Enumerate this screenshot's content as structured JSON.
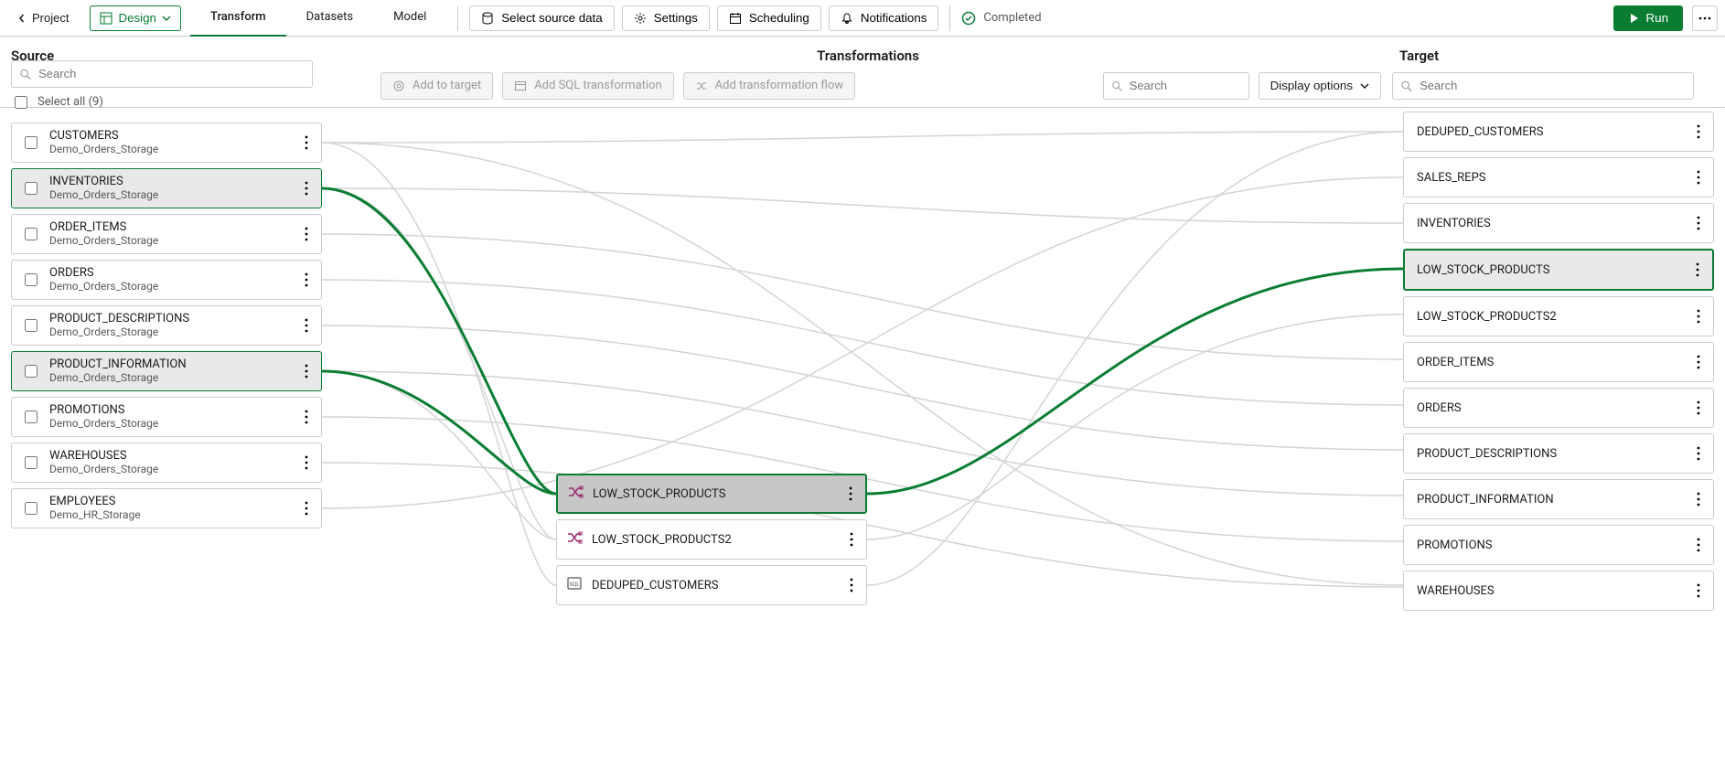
{
  "topbar": {
    "back_label": "Project",
    "design_label": "Design",
    "tabs": [
      "Transform",
      "Datasets",
      "Model"
    ],
    "active_tab": 0,
    "cmds": {
      "select_source": "Select source data",
      "settings": "Settings",
      "scheduling": "Scheduling",
      "notifications": "Notifications"
    },
    "status_label": "Completed",
    "run_label": "Run"
  },
  "headers": {
    "source": "Source",
    "mid": "Transformations",
    "target": "Target"
  },
  "source": {
    "search_placeholder": "Search",
    "select_all_label": "Select all (9)",
    "items": [
      {
        "name": "CUSTOMERS",
        "sub": "Demo_Orders_Storage",
        "selected": false
      },
      {
        "name": "INVENTORIES",
        "sub": "Demo_Orders_Storage",
        "selected": true
      },
      {
        "name": "ORDER_ITEMS",
        "sub": "Demo_Orders_Storage",
        "selected": false
      },
      {
        "name": "ORDERS",
        "sub": "Demo_Orders_Storage",
        "selected": false
      },
      {
        "name": "PRODUCT_DESCRIPTIONS",
        "sub": "Demo_Orders_Storage",
        "selected": false
      },
      {
        "name": "PRODUCT_INFORMATION",
        "sub": "Demo_Orders_Storage",
        "selected": true
      },
      {
        "name": "PROMOTIONS",
        "sub": "Demo_Orders_Storage",
        "selected": false
      },
      {
        "name": "WAREHOUSES",
        "sub": "Demo_Orders_Storage",
        "selected": false
      },
      {
        "name": "EMPLOYEES",
        "sub": "Demo_HR_Storage",
        "selected": false
      }
    ]
  },
  "mid": {
    "add_to_target": "Add to target",
    "add_sql": "Add SQL transformation",
    "add_flow": "Add transformation flow",
    "search_placeholder": "Search",
    "display_options": "Display options",
    "items": [
      {
        "name": "LOW_STOCK_PRODUCTS",
        "type": "flow",
        "selected": true
      },
      {
        "name": "LOW_STOCK_PRODUCTS2",
        "type": "flow",
        "selected": false
      },
      {
        "name": "DEDUPED_CUSTOMERS",
        "type": "sql",
        "selected": false
      }
    ]
  },
  "target": {
    "search_placeholder": "Search",
    "items": [
      {
        "name": "DEDUPED_CUSTOMERS",
        "selected": false
      },
      {
        "name": "SALES_REPS",
        "selected": false
      },
      {
        "name": "INVENTORIES",
        "selected": false
      },
      {
        "name": "LOW_STOCK_PRODUCTS",
        "selected": true
      },
      {
        "name": "LOW_STOCK_PRODUCTS2",
        "selected": false
      },
      {
        "name": "ORDER_ITEMS",
        "selected": false
      },
      {
        "name": "ORDERS",
        "selected": false
      },
      {
        "name": "PRODUCT_DESCRIPTIONS",
        "selected": false
      },
      {
        "name": "PRODUCT_INFORMATION",
        "selected": false
      },
      {
        "name": "PROMOTIONS",
        "selected": false
      },
      {
        "name": "WAREHOUSES",
        "selected": false
      }
    ]
  }
}
